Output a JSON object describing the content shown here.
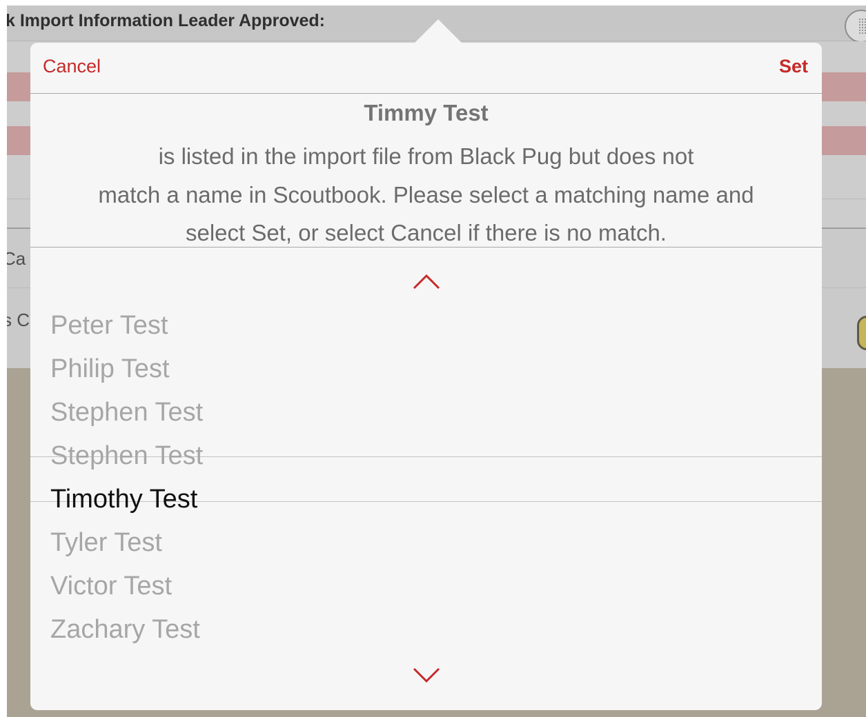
{
  "background": {
    "header_title": "k Import Information Leader Approved:",
    "fragment_1": "Ca",
    "fragment_2": "s C"
  },
  "dialog": {
    "cancel_label": "Cancel",
    "set_label": "Set",
    "unmatched_name": "Timmy Test",
    "message_lines": [
      "is listed in the import file from Black Pug but does not",
      "match a name in Scoutbook. Please select a matching name and",
      "select Set, or select Cancel if there is no match."
    ]
  },
  "picker": {
    "options": [
      "Peter Test",
      "Philip Test",
      "Stephen Test",
      "Stephen Test",
      "Timothy Test",
      "Tyler Test",
      "Victor Test",
      "Zachary Test"
    ],
    "selected": "Timothy Test"
  },
  "colors": {
    "accent": "#c62a2a",
    "selected_text": "#111111",
    "unselected_text": "#a6a6a6",
    "overlay": "#aaa293"
  }
}
